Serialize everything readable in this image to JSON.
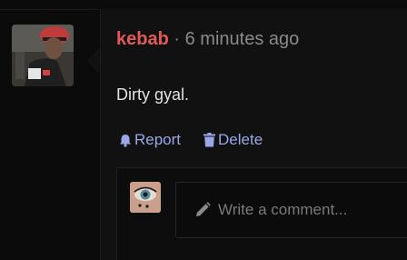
{
  "comment": {
    "username": "kebab",
    "separator": "·",
    "timestamp": "6 minutes ago",
    "text": "Dirty gyal."
  },
  "actions": {
    "report_label": "Report",
    "delete_label": "Delete"
  },
  "reply": {
    "placeholder": "Write a comment..."
  },
  "icons": {
    "report": "bell-icon",
    "delete": "trash-icon",
    "reply": "pencil-icon"
  },
  "colors": {
    "username": "#e15a5a",
    "action_link": "#9aa8e8",
    "background": "#0b0b0b"
  }
}
